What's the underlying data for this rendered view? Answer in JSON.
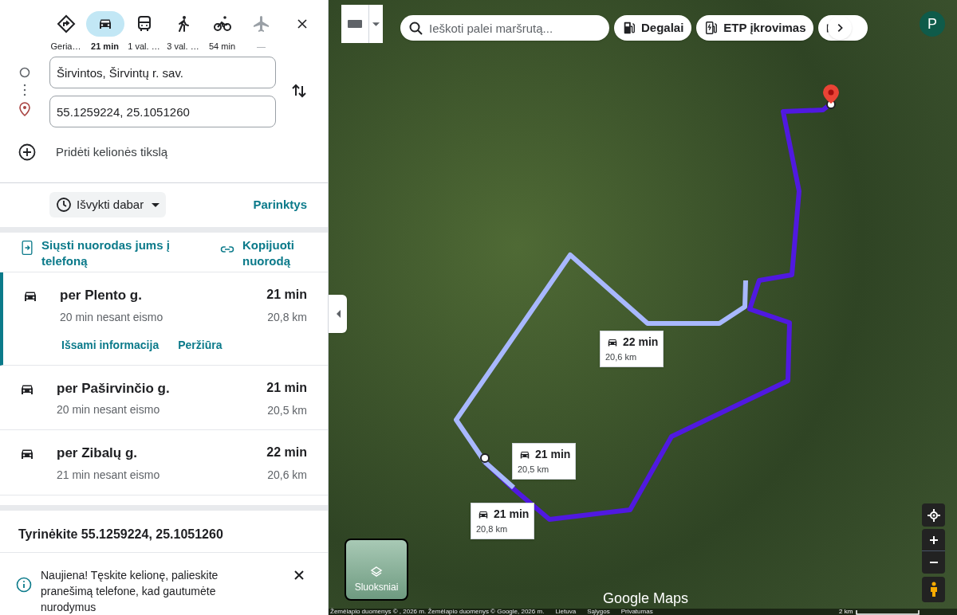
{
  "modes": [
    {
      "kind": "best",
      "label": "Geria…",
      "selected": false,
      "disabled": false
    },
    {
      "kind": "car",
      "label": "21 min",
      "selected": true,
      "disabled": false
    },
    {
      "kind": "transit",
      "label": "1 val. …",
      "selected": false,
      "disabled": false
    },
    {
      "kind": "walk",
      "label": "3 val. …",
      "selected": false,
      "disabled": false
    },
    {
      "kind": "bike",
      "label": "54 min",
      "selected": false,
      "disabled": false
    },
    {
      "kind": "flight",
      "label": "—",
      "selected": false,
      "disabled": true
    }
  ],
  "origin": {
    "value": "Širvintos, Širvintų r. sav."
  },
  "destination": {
    "value": "55.1259224, 25.1051260"
  },
  "add_destination": "Pridėti kelionės tikslą",
  "depart": "Išvykti dabar",
  "options": "Parinktys",
  "send": "Siųsti nuorodas jums į telefoną",
  "copy": "Kopijuoti nuorodą",
  "routes": [
    {
      "via": "per Plento g.",
      "note": "20 min nesant eismo",
      "time": "21 min",
      "distance": "20,8 km",
      "selected": true,
      "links": [
        "Išsami informacija",
        "Peržiūra"
      ]
    },
    {
      "via": "per Paširvinčio g.",
      "note": "20 min nesant eismo",
      "time": "21 min",
      "distance": "20,5 km",
      "selected": false
    },
    {
      "via": "per Zibalų g.",
      "note": "21 min nesant eismo",
      "time": "22 min",
      "distance": "20,6 km",
      "selected": false
    }
  ],
  "explore": "Tyrinėkite 55.1259224, 25.1051260",
  "notice": "Naujiena! Tęskite kelionę, palieskite pranešimą telefone, kad gautumėte nurodymus",
  "map": {
    "search": {
      "placeholder": "Ieškoti palei maršrutą..."
    },
    "chips": [
      {
        "kind": "fuel",
        "label": "Degalai"
      },
      {
        "kind": "ev",
        "label": "ETP įkrovimas"
      },
      {
        "kind": "hotel"
      }
    ],
    "avatar": "P",
    "route_badges": [
      {
        "time": "22 min",
        "distance": "20,6 km"
      },
      {
        "time": "21 min",
        "distance": "20,5 km"
      },
      {
        "time": "21 min",
        "distance": "20,8 km"
      }
    ],
    "layers": "Sluoksniai",
    "logo": "Google Maps",
    "attribution": [
      "Žemėlapio duomenys © , 2026 m. Žemėlapio duomenys © Google, 2026 m.",
      "Lietuva",
      "Sąlygos",
      "Privatumas"
    ],
    "scale": "2 km"
  }
}
